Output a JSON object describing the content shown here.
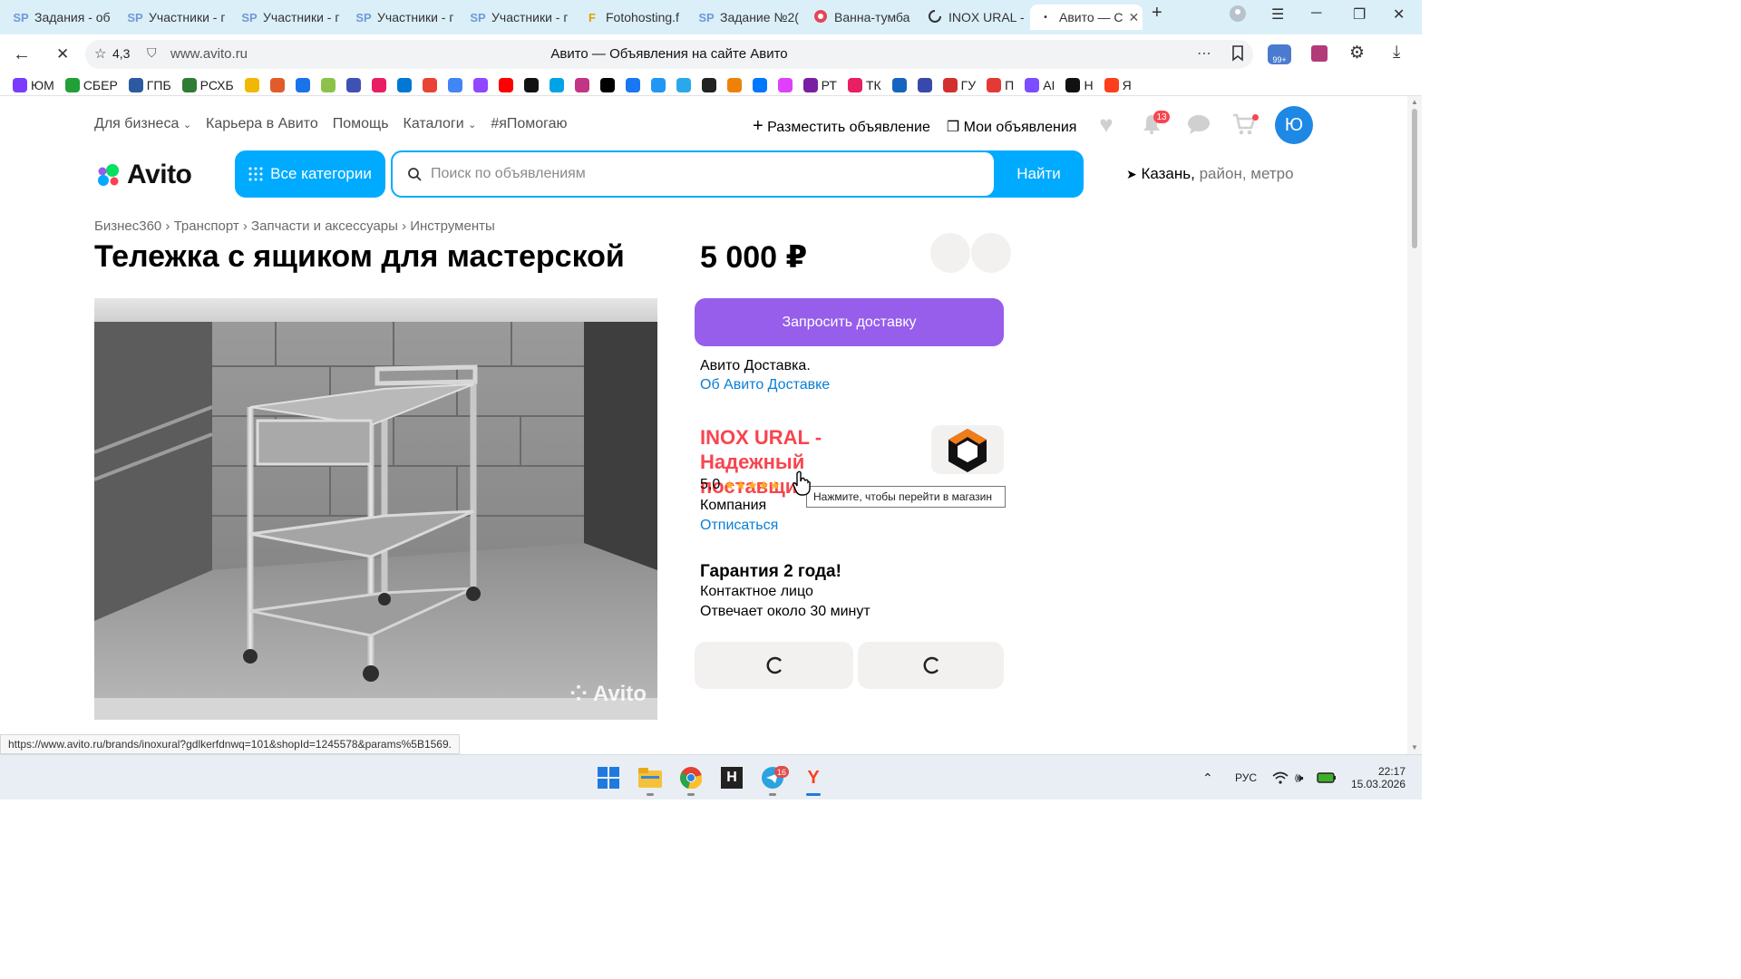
{
  "browser": {
    "tabs": [
      {
        "icon": "sp-icon",
        "label": "Задания - об"
      },
      {
        "icon": "sp-icon",
        "label": "Участники - г"
      },
      {
        "icon": "sp-icon",
        "label": "Участники - г"
      },
      {
        "icon": "sp-icon",
        "label": "Участники - г"
      },
      {
        "icon": "sp-icon",
        "label": "Участники - г"
      },
      {
        "icon": "fotohosting-icon",
        "label": "Fotohosting.f"
      },
      {
        "icon": "sp-icon",
        "label": "Задание №2("
      },
      {
        "icon": "record-icon",
        "label": "Ванна-тумба"
      },
      {
        "icon": "loading-icon",
        "label": "INOX URAL -"
      },
      {
        "icon": "avito-icon",
        "label": "Авито — С"
      }
    ],
    "rating": "4,3",
    "url": "www.avito.ru",
    "page_title": "Авито — Объявления на сайте Авито",
    "bookmarks": [
      {
        "label": "ЮМ",
        "color": "#7a3cff"
      },
      {
        "label": "СБЕР",
        "color": "#21a038"
      },
      {
        "label": "ГПБ",
        "color": "#2c5aa0"
      },
      {
        "label": "РСХБ",
        "color": "#2e7d32"
      },
      {
        "label": "",
        "color": "#f2b705"
      },
      {
        "label": "",
        "color": "#e25b2a"
      },
      {
        "label": "",
        "color": "#1a73e8"
      },
      {
        "label": "",
        "color": "#8bc34a"
      },
      {
        "label": "",
        "color": "#3f51b5"
      },
      {
        "label": "",
        "color": "#e91e63"
      },
      {
        "label": "",
        "color": "#0078d4"
      },
      {
        "label": "",
        "color": "#ea4335"
      },
      {
        "label": "",
        "color": "#4285f4"
      },
      {
        "label": "",
        "color": "#9146ff"
      },
      {
        "label": "",
        "color": "#ff0000"
      },
      {
        "label": "",
        "color": "#111111"
      },
      {
        "label": "",
        "color": "#00a4e4"
      },
      {
        "label": "",
        "color": "#c13584"
      },
      {
        "label": "",
        "color": "#000000"
      },
      {
        "label": "",
        "color": "#1877f2"
      },
      {
        "label": "",
        "color": "#2196f3"
      },
      {
        "label": "",
        "color": "#29a9eb"
      },
      {
        "label": "",
        "color": "#222222"
      },
      {
        "label": "",
        "color": "#ee8208"
      },
      {
        "label": "",
        "color": "#0077ff"
      },
      {
        "label": "",
        "color": "#e040fb"
      },
      {
        "label": "РТ",
        "color": "#7b1fa2"
      },
      {
        "label": "ТК",
        "color": "#e91e63"
      },
      {
        "label": "",
        "color": "#1565c0"
      },
      {
        "label": "",
        "color": "#3949ab"
      },
      {
        "label": "ГУ",
        "color": "#d32f2f"
      },
      {
        "label": "П",
        "color": "#e53935"
      },
      {
        "label": "AI",
        "color": "#7c4dff"
      },
      {
        "label": "Н",
        "color": "#111111"
      },
      {
        "label": "Я",
        "color": "#fc3f1d"
      }
    ]
  },
  "site": {
    "nav": [
      "Для бизнеса",
      "Карьера в Авито",
      "Помощь",
      "Каталоги",
      "#яПомогаю"
    ],
    "post_ad": "Разместить объявление",
    "my_ads": "Мои объявления",
    "notifications_count": "13",
    "avatar_letter": "Ю",
    "logo_text": "Avito",
    "all_categories": "Все категории",
    "search_placeholder": "Поиск по объявлениям",
    "search_button": "Найти",
    "location_city": "Казань,",
    "location_hint": " район, метро"
  },
  "listing": {
    "breadcrumbs": "Бизнес360 › Транспорт › Запчасти и аксессуары › Инструменты",
    "title": "Тележка с ящиком для мастерской",
    "price": "5 000 ₽",
    "photo_watermark": "Avito",
    "delivery_button": "Запросить доставку",
    "delivery_note": "Авито Доставка.",
    "delivery_link": "Об Авито Доставке",
    "seller_name": "INOX URAL - Надежный поставщик...",
    "seller_rating": "5,0",
    "seller_type": "Компания",
    "unsubscribe": "Отписаться",
    "tooltip": "Нажмите, чтобы перейти в магазин",
    "guarantee": "Гарантия 2 года!",
    "contact_person": "Контактное лицо",
    "response_time": "Отвечает около 30 минут"
  },
  "status_url": "https://www.avito.ru/brands/inoxural?gdlkerfdnwq=101&shopId=1245578&params%5B1569.",
  "taskbar": {
    "telegram_badge": "16",
    "language": "РУС",
    "time": "22:17",
    "date": "15.03.2026"
  }
}
